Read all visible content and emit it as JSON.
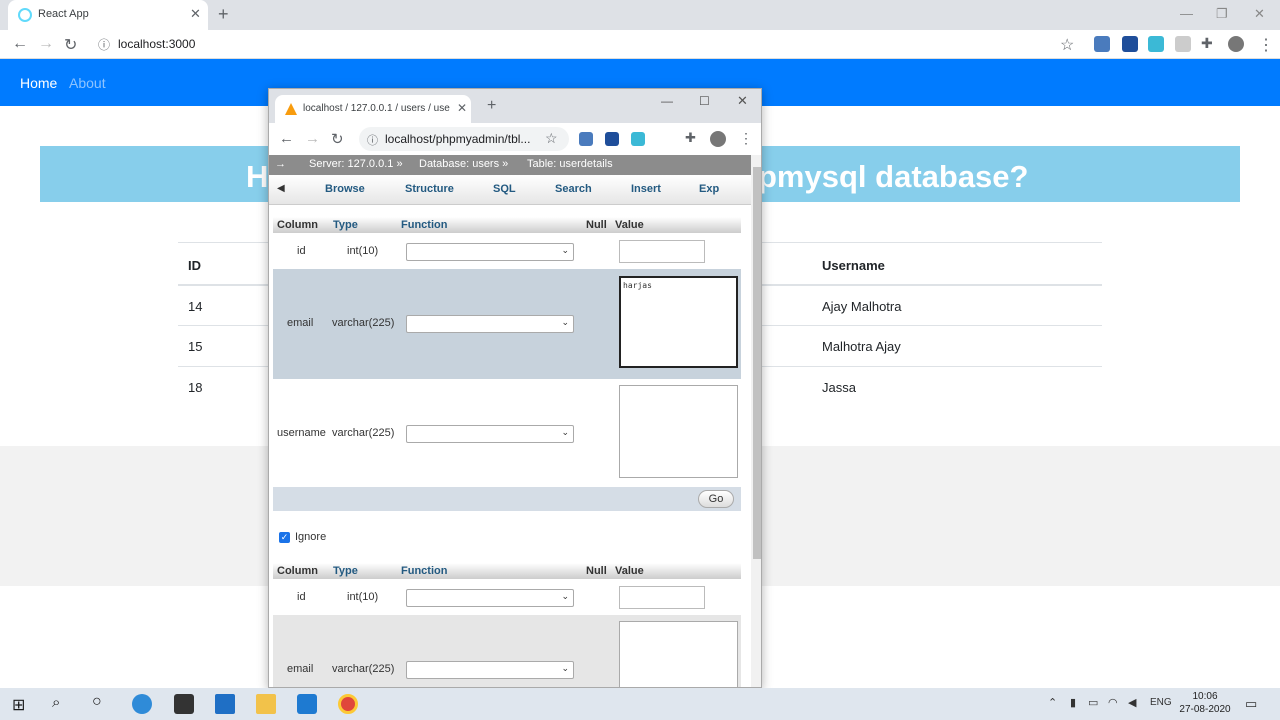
{
  "browser": {
    "tab_title": "React App",
    "url": "localhost:3000"
  },
  "app": {
    "nav": {
      "home": "Home",
      "about": "About"
    },
    "banner_left": "H",
    "banner_right": "pmysql database?",
    "table": {
      "headers": {
        "id": "ID",
        "username": "Username"
      },
      "rows": [
        {
          "id": "14",
          "username": "Ajay Malhotra"
        },
        {
          "id": "15",
          "username": "Malhotra Ajay"
        },
        {
          "id": "18",
          "username": "Jassa"
        }
      ]
    }
  },
  "popup": {
    "tab_title": "localhost / 127.0.0.1 / users / use",
    "url": "localhost/phpmyadmin/tbl...",
    "breadcrumb": {
      "server": "Server: 127.0.0.1 »",
      "database": "Database: users »",
      "table": "Table: userdetails"
    },
    "tabs": [
      "Browse",
      "Structure",
      "SQL",
      "Search",
      "Insert",
      "Exp"
    ],
    "headers": {
      "column": "Column",
      "type": "Type",
      "function": "Function",
      "null": "Null",
      "value": "Value"
    },
    "rows1": [
      {
        "column": "id",
        "type": "int(10)",
        "value": ""
      },
      {
        "column": "email",
        "type": "varchar(225)",
        "value": "harjas"
      },
      {
        "column": "username",
        "type": "varchar(225)",
        "value": ""
      }
    ],
    "go_label": "Go",
    "ignore_label": "Ignore",
    "rows2": [
      {
        "column": "id",
        "type": "int(10)"
      },
      {
        "column": "email",
        "type": "varchar(225)"
      }
    ]
  },
  "taskbar": {
    "language": "ENG",
    "time": "10:06",
    "date": "27-08-2020"
  },
  "colors": {
    "navbar": "#007bff",
    "banner": "#87ceeb"
  }
}
